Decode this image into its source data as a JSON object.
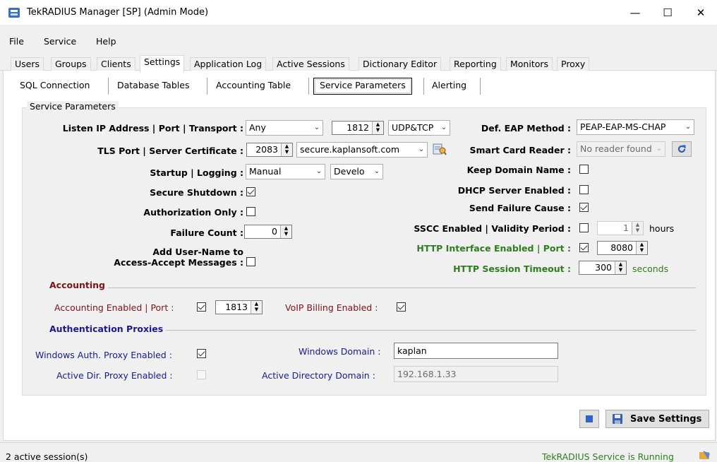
{
  "window": {
    "title": "TekRADIUS Manager [SP] (Admin Mode)",
    "minimize": "—",
    "maximize": "☐",
    "close": "✕"
  },
  "menu": [
    "File",
    "Service",
    "Help"
  ],
  "main_tabs": [
    "Users",
    "Groups",
    "Clients",
    "Settings",
    "Application Log",
    "Active Sessions",
    "Dictionary Editor",
    "Reporting",
    "Monitors",
    "Proxy"
  ],
  "sub_tabs": [
    "SQL Connection",
    "Database Tables",
    "Accounting Table",
    "Service Parameters",
    "Alerting"
  ],
  "group_title": "Service Parameters",
  "left": {
    "listen_label": "Listen IP Address | Port | Transport :",
    "listen_ip": "Any",
    "listen_port": "1812",
    "transport": "UDP&TCP",
    "tls_label": "TLS Port | Server Certificate :",
    "tls_port": "2083",
    "certificate": "secure.kaplansoft.com",
    "startup_label": "Startup | Logging :",
    "startup": "Manual",
    "logging": "Develo",
    "secure_shutdown_label": "Secure Shutdown :",
    "secure_shutdown": true,
    "auth_only_label": "Authorization Only :",
    "auth_only": false,
    "failure_count_label": "Failure Count :",
    "failure_count": "0",
    "add_user_label_1": "Add User-Name to",
    "add_user_label_2": "Access-Accept Messages :",
    "add_user": false
  },
  "right": {
    "eap_label": "Def. EAP Method :",
    "eap": "PEAP-EAP-MS-CHAP",
    "smart_card_label": "Smart Card Reader :",
    "smart_card": "No reader found",
    "keep_domain_label": "Keep Domain Name :",
    "keep_domain": false,
    "dhcp_label": "DHCP Server Enabled :",
    "dhcp": false,
    "send_failure_label": "Send Failure Cause :",
    "send_failure": true,
    "sscc_label": "SSCC Enabled | Validity Period :",
    "sscc": false,
    "validity": "1",
    "validity_unit": "hours",
    "http_label": "HTTP Interface Enabled | Port :",
    "http": true,
    "http_port": "8080",
    "http_timeout_label": "HTTP Session Timeout :",
    "http_timeout": "300",
    "timeout_unit": "seconds"
  },
  "accounting": {
    "title": "Accounting",
    "enabled_label": "Accounting Enabled | Port :",
    "enabled": true,
    "port": "1813",
    "voip_label": "VoIP Billing Enabled :",
    "voip": true
  },
  "proxies": {
    "title": "Authentication Proxies",
    "win_label": "Windows Auth. Proxy Enabled :",
    "win": true,
    "ad_label": "Active Dir. Proxy Enabled :",
    "ad": false,
    "win_domain_label": "Windows Domain :",
    "win_domain": "kaplan",
    "ad_domain_label": "Active Directory Domain :",
    "ad_domain": "192.168.1.33"
  },
  "save_label": "Save Settings",
  "status": {
    "left": "2 active session(s)",
    "right": "TekRADIUS Service is Running"
  },
  "colors": {
    "green": "#2e7d1e",
    "maroon": "#7b1414",
    "navy": "#1a1a8c"
  }
}
